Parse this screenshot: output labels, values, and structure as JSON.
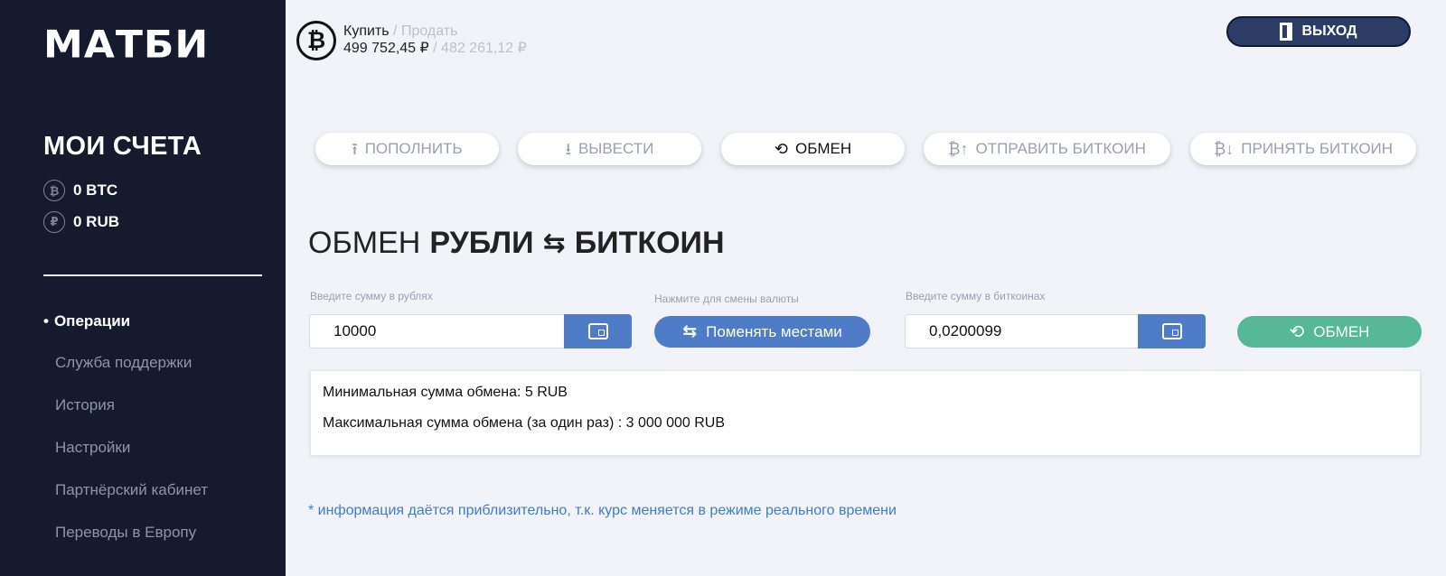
{
  "brand": {
    "logo_text": "МАТБИ"
  },
  "sidebar": {
    "accounts_title": "МОИ СЧЕТА",
    "accounts": [
      {
        "icon": "bitcoin-coin-icon",
        "symbol": "₿",
        "label": "0 BTC"
      },
      {
        "icon": "ruble-coin-icon",
        "symbol": "₽",
        "label": "0 RUB"
      }
    ],
    "nav": [
      {
        "label": "Операции",
        "active": true
      },
      {
        "label": "Служба поддержки",
        "active": false
      },
      {
        "label": "История",
        "active": false
      },
      {
        "label": "Настройки",
        "active": false
      },
      {
        "label": "Партнёрский кабинет",
        "active": false
      },
      {
        "label": "Переводы в Европу",
        "active": false
      }
    ]
  },
  "header": {
    "btc_symbol": "₿",
    "buy_label": "Купить",
    "sell_label": "/ Продать",
    "buy_price": "499 752,45 ₽",
    "sell_price": "/ 482 261,12 ₽",
    "logout_label": "ВЫХОД"
  },
  "tabs": [
    {
      "label": "ПОПОЛНИТЬ",
      "icon": "upload-icon",
      "glyph": "⭱",
      "active": false
    },
    {
      "label": "ВЫВЕСТИ",
      "icon": "download-icon",
      "glyph": "⭳",
      "active": false
    },
    {
      "label": "ОБМЕН",
      "icon": "exchange-icon",
      "glyph": "⟲",
      "active": true
    },
    {
      "label": "ОТПРАВИТЬ БИТКОИН",
      "icon": "bitcoin-send-icon",
      "glyph": "₿↑",
      "active": false
    },
    {
      "label": "ПРИНЯТЬ БИТКОИН",
      "icon": "bitcoin-receive-icon",
      "glyph": "₿↓",
      "active": false
    }
  ],
  "exchange": {
    "heading_light": "ОБМЕН",
    "heading_from": "РУБЛИ",
    "heading_arrows": "⇆",
    "heading_to": "БИТКОИН",
    "rub_label": "Введите сумму в рублях",
    "rub_value": "10000",
    "swap_hint": "Нажмите для смены валюты",
    "swap_button": "Поменять местами",
    "swap_arrows": "⇆",
    "btc_label": "Введите сумму в биткоинах",
    "btc_value": "0,0200099",
    "exchange_button": "ОБМЕН",
    "exchange_glyph": "⟲"
  },
  "info": {
    "min_line": "Минимальная сумма обмена: 5 RUB",
    "max_line": "Максимальная сумма обмена (за один раз) : 3 000 000 RUB"
  },
  "footnote": "* информация даётся приблизительно, т.к. курс меняется в режиме реального времени",
  "colors": {
    "sidebar_bg": "#151b2d",
    "primary_blue": "#4f7cc6",
    "exchange_green": "#56b896",
    "logout_navy": "#2b3d65",
    "link_blue": "#3d7ec8"
  }
}
